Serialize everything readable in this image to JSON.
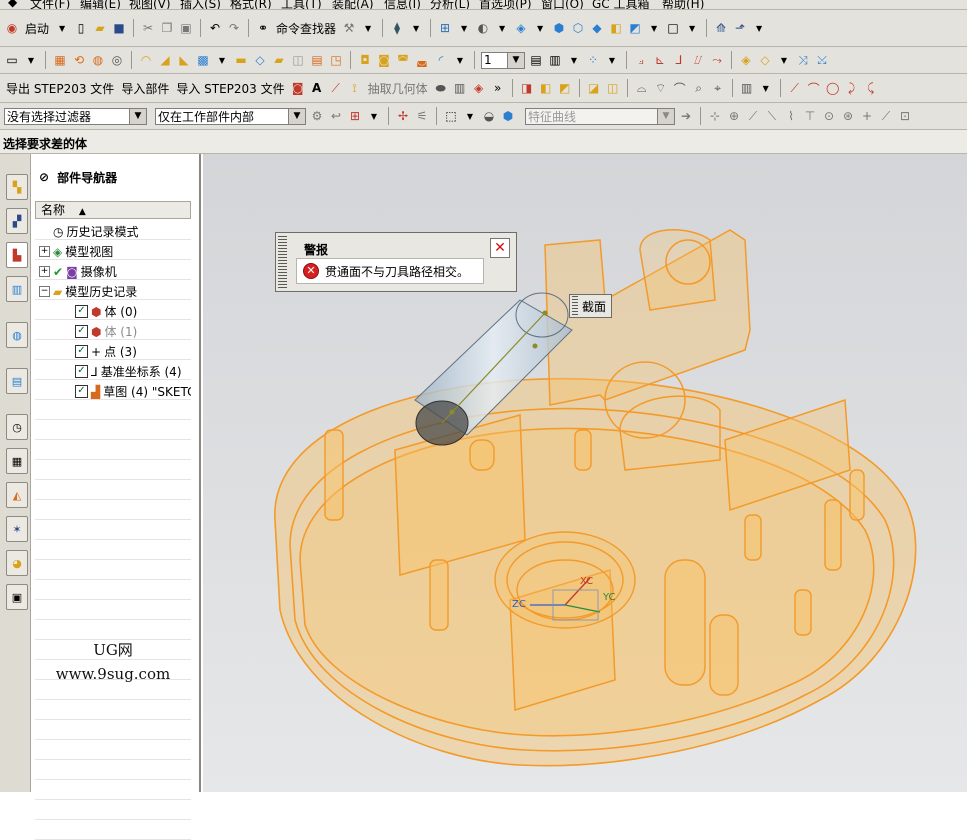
{
  "menu": [
    "文件(F)",
    "编辑(E)",
    "视图(V)",
    "插入(S)",
    "格式(R)",
    "工具(T)",
    "装配(A)",
    "信息(I)",
    "分析(L)",
    "首选项(P)",
    "窗口(O)",
    "GC 工具箱",
    "帮助(H)"
  ],
  "toolbar1": {
    "start_label": "启动",
    "command_finder_label": "命令查找器"
  },
  "toolbar2": {
    "layer_value": "1"
  },
  "toolbar3": {
    "export_step": "导出 STEP203 文件",
    "import_part": "导入部件",
    "import_step": "导入 STEP203 文件",
    "extract_geometry": "抽取几何体"
  },
  "filter_bar": {
    "selection_filter": "没有选择过滤器",
    "scope": "仅在工作部件内部",
    "curve_rule": "特征曲线"
  },
  "status_prompt": "选择要求差的体",
  "navigator": {
    "title": "部件导航器",
    "column_header": "名称",
    "items": [
      {
        "label": "历史记录模式",
        "indent": 0
      },
      {
        "label": "模型视图",
        "indent": 0
      },
      {
        "label": "摄像机",
        "indent": 0
      },
      {
        "label": "模型历史记录",
        "indent": 0
      },
      {
        "label": "体 (0)",
        "indent": 1
      },
      {
        "label": "体 (1)",
        "indent": 1
      },
      {
        "label": "点 (3)",
        "indent": 1
      },
      {
        "label": "基准坐标系 (4)",
        "indent": 1
      },
      {
        "label": "草图 (4) \"SKETC",
        "indent": 1
      }
    ],
    "watermark_line1": "UG网",
    "watermark_line2": "www.9sug.com"
  },
  "alert": {
    "title": "警报",
    "message": "贯通面不与刀具路径相交。"
  },
  "section_label": "截面",
  "axis_labels": {
    "x": "XC",
    "y": "YC",
    "z": "ZC"
  },
  "colors": {
    "model_orange": "#f39a2a",
    "model_fill": "#f7c46a",
    "cylinder": "#c9d9e6",
    "error_red": "#d62020"
  }
}
